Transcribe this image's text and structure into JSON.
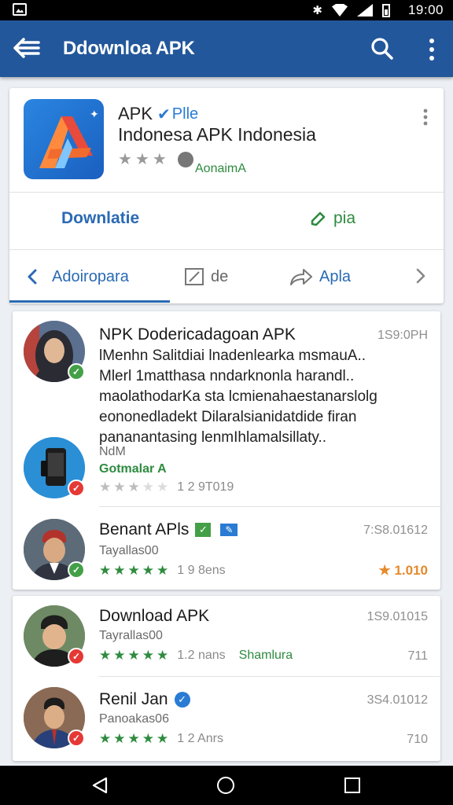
{
  "statusbar": {
    "time": "19:00"
  },
  "appbar": {
    "title": "Ddownloa APK"
  },
  "app_card": {
    "title": "APK",
    "tag": "Plle",
    "subtitle": "Indonesa APK Indonesia",
    "developer": "AonaimA",
    "rating_stars": 3,
    "action_left": "Downlatie",
    "action_right": "pia",
    "tabs": [
      {
        "label": "Adoiropara"
      },
      {
        "label": "de"
      },
      {
        "label": "Apla"
      }
    ]
  },
  "feed": [
    {
      "title": "NPK Dodericadagoan APK",
      "time": "1S9:0PH",
      "desc": [
        "lMenhn Salitdiai lnadenlearka msmauA..",
        "Mlerl 1matthasa nndarknonla harandl..",
        "maolathodarKa sta lcmienahaestanarslolg",
        "eononedladekt Dilaralsianidatdide firan",
        "pananantasing lenmIhlamalsillaty.."
      ]
    },
    {
      "title": "",
      "sub": "NdM",
      "dev": "Gotmalar A",
      "stars": 3,
      "count": "1 2 9T019"
    },
    {
      "title": "Benant APls",
      "time": "7:S8.01612",
      "sub": "Tayallas00",
      "stars": 5,
      "count": "1 9 8ens",
      "rating": "1.010"
    },
    {
      "title": "Download APK",
      "time": "1S9.01015",
      "sub": "Tayrallas00",
      "stars": 5,
      "count": "1.2 nans",
      "dev": "Shamlura",
      "right": "711"
    },
    {
      "title": "Renil Jan",
      "time": "3S4.01012",
      "sub": "Panoakas06",
      "stars": 5,
      "count": "1 2 Anrs",
      "right": "710"
    }
  ],
  "icons": [
    "menu-back-icon",
    "search-icon",
    "more-vert-icon",
    "info-icon",
    "check-badge-icon",
    "share-icon",
    "edit-icon",
    "chevron-left-icon",
    "chevron-right-icon",
    "star-icon",
    "nav-back-icon",
    "nav-home-icon",
    "nav-recents-icon"
  ],
  "colors": {
    "appbar": "#23579b",
    "accent_blue": "#2a6ab4",
    "green": "#2e8b3f",
    "orange": "#e6892b"
  }
}
